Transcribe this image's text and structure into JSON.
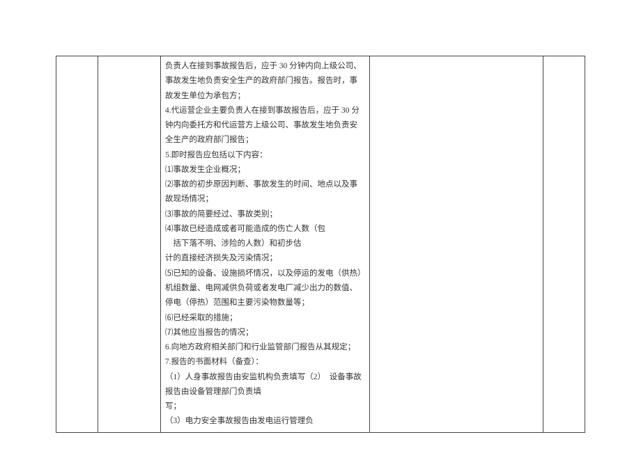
{
  "table": {
    "row": {
      "col1": "",
      "col2": "",
      "col3_lines": [
        "负责人在接到事故报告后，应于 30 分钟内向上级公司、事故发生地负责安全生产的政府部门报告。报告时，事故发生单位为承包方；",
        "4.代运营企业主要负责人在接到事故报告后，应于 30 分钟内向委托方和代运营方上级公司、事故发生地负责安全生产的政府部门报告；",
        "5.即时报告应包括以下内容：",
        "⑴事故发生企业概况；",
        "⑵事故的初步原因判断、事故发生的时间、地点以及事故现场情况；",
        "⑶事故的简要经过、事故类别；",
        "⑷事故已经造成或者可能造成的伤亡人数（包\n　括下落不明、涉险的人数）和初步估",
        "计的直接经济损失及污染情况；",
        "⑸已知的设备、设施损坏情况，以及停运的发电（供热）机组数量、电网减供负荷或者发电厂减少出力的数值、停电（停热）范围和主要污染物数量等；",
        "⑹已经采取的措施；",
        "⑺其他应当报告的情况；",
        "6.向地方政府相关部门和行业监管部门报告从其规定；",
        "7.报告的书面材料（备查）：",
        "（1）人身事故报告由安监机构负责填写（2）　设备事故报告由设备管理部门负责填",
        "写；",
        "（3）电力安全事故报告由发电运行管理负"
      ],
      "col4": "",
      "col5": ""
    }
  }
}
